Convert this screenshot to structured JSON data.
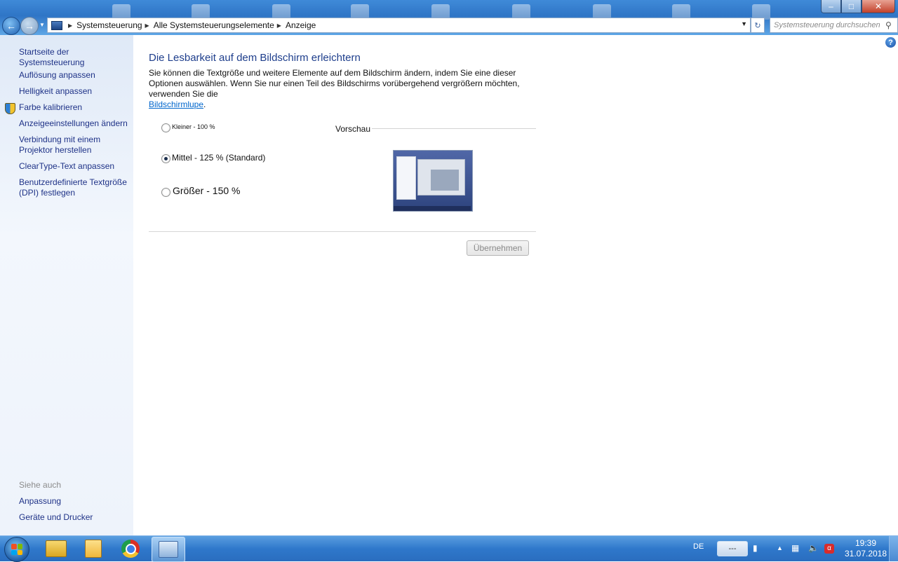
{
  "window": {
    "search_placeholder": "Systemsteuerung durchsuchen",
    "breadcrumbs": [
      "Systemsteuerung",
      "Alle Systemsteuerungselemente",
      "Anzeige"
    ],
    "buttons": {
      "minimize": "–",
      "maximize": "□",
      "close": "✕"
    }
  },
  "sidebar": {
    "home_link": "Startseite der Systemsteuerung",
    "links": [
      "Auflösung anpassen",
      "Helligkeit anpassen",
      "Farbe kalibrieren",
      "Anzeigeeinstellungen ändern",
      "Verbindung mit einem\nProjektor herstellen",
      "ClearType-Text anpassen",
      "Benutzerdefinierte Textgröße\n(DPI) festlegen"
    ],
    "see_also_title": "Siehe auch",
    "see_also_links": [
      "Anpassung",
      "Geräte und Drucker"
    ]
  },
  "main": {
    "title": "Die Lesbarkeit auf dem Bildschirm erleichtern",
    "description": "Sie können die Textgröße und weitere Elemente auf dem Bildschirm ändern, indem Sie eine dieser Optionen auswählen. Wenn Sie nur einen Teil des Bildschirms vorübergehend vergrößern möchten, verwenden Sie die",
    "description_link": "Bildschirmlupe",
    "description_end": ".",
    "options": [
      {
        "label": "Kleiner - 100 %",
        "selected": false
      },
      {
        "label": "Mittel - 125 % (Standard)",
        "selected": true
      },
      {
        "label": "Größer - 150 %",
        "selected": false
      }
    ],
    "preview_label": "Vorschau",
    "apply_button": "Übernehmen",
    "apply_enabled": false
  },
  "taskbar": {
    "apps": [
      "explorer-icon",
      "sticky-notes-icon",
      "chrome-icon",
      "control-panel-icon"
    ],
    "active_app": "control-panel-icon",
    "language": "DE",
    "tray_box": "---",
    "time": "19:39",
    "date": "31.07.2018"
  },
  "colors": {
    "link": "#1e3287",
    "title": "#1e3e8c",
    "sidebar_bg": "#e6eef9",
    "taskbar": "#2f78cb"
  }
}
